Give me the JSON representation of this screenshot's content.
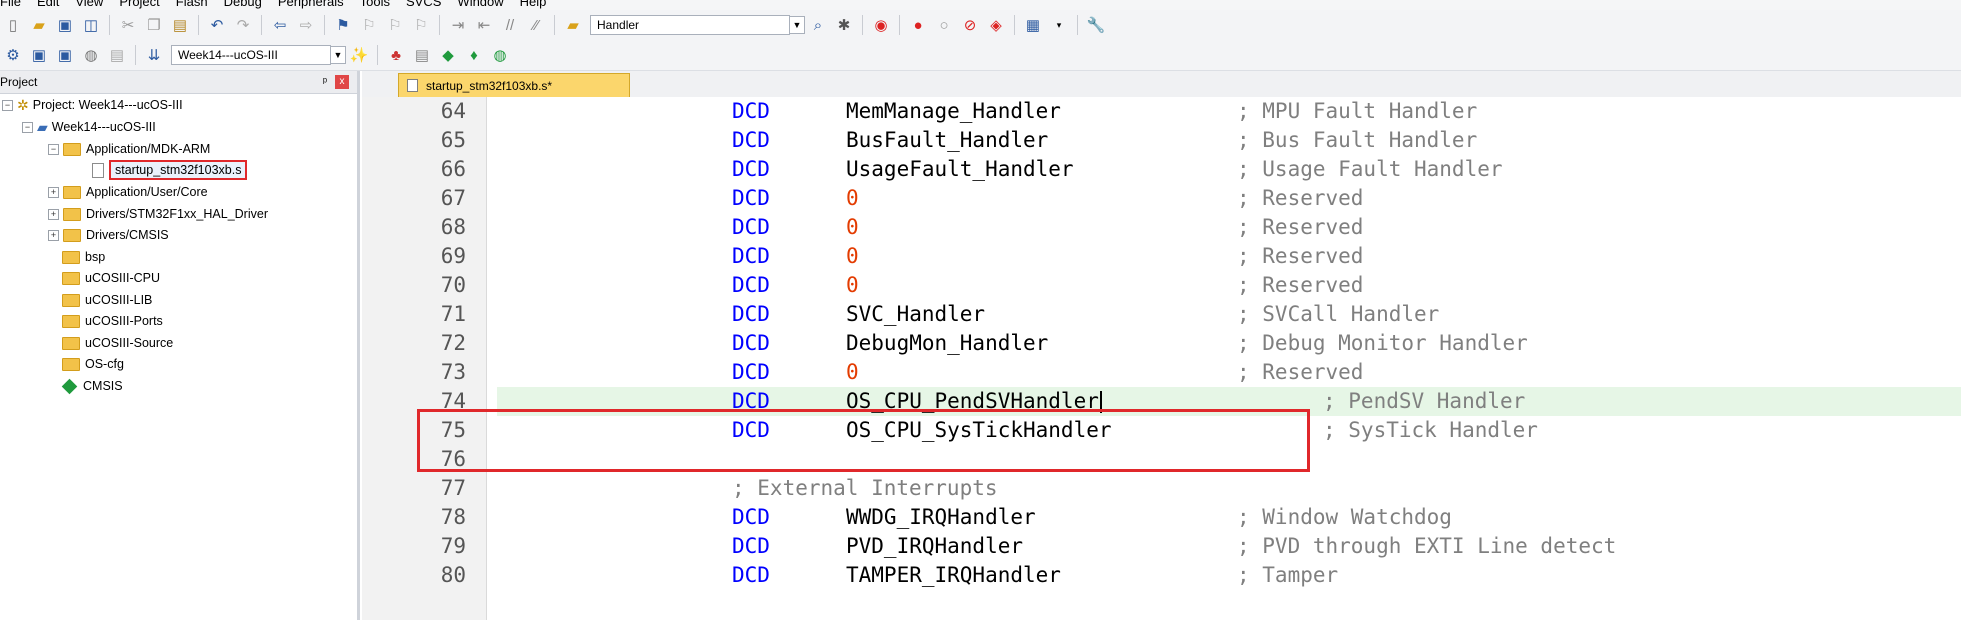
{
  "menubar": {
    "items": [
      "File",
      "Edit",
      "View",
      "Project",
      "Flash",
      "Debug",
      "Peripherals",
      "Tools",
      "SVCS",
      "Window",
      "Help"
    ]
  },
  "toolbar1": {
    "find_combo_value": "Handler"
  },
  "toolbar2": {
    "target_combo_value": "Week14---ucOS-III"
  },
  "project_panel": {
    "title": "Project",
    "pin_label": "ᵖ",
    "close_label": "x",
    "tree": [
      {
        "label": "Project: Week14---ucOS-III"
      },
      {
        "label": "Week14---ucOS-III"
      },
      {
        "label": "Application/MDK-ARM"
      },
      {
        "label": "startup_stm32f103xb.s"
      },
      {
        "label": "Application/User/Core"
      },
      {
        "label": "Drivers/STM32F1xx_HAL_Driver"
      },
      {
        "label": "Drivers/CMSIS"
      },
      {
        "label": "bsp"
      },
      {
        "label": "uCOSIII-CPU"
      },
      {
        "label": "uCOSIII-LIB"
      },
      {
        "label": "uCOSIII-Ports"
      },
      {
        "label": "uCOSIII-Source"
      },
      {
        "label": "OS-cfg"
      },
      {
        "label": "CMSIS"
      }
    ]
  },
  "editor": {
    "tab_label": "startup_stm32f103xb.s*",
    "lines": [
      {
        "num": "64",
        "kw": "DCD",
        "sym": "MemManage_Handler",
        "comment": "; MPU Fault Handler"
      },
      {
        "num": "65",
        "kw": "DCD",
        "sym": "BusFault_Handler",
        "comment": "; Bus Fault Handler"
      },
      {
        "num": "66",
        "kw": "DCD",
        "sym": "UsageFault_Handler",
        "comment": "; Usage Fault Handler"
      },
      {
        "num": "67",
        "kw": "DCD",
        "sym": "0",
        "comment": "; Reserved"
      },
      {
        "num": "68",
        "kw": "DCD",
        "sym": "0",
        "comment": "; Reserved"
      },
      {
        "num": "69",
        "kw": "DCD",
        "sym": "0",
        "comment": "; Reserved"
      },
      {
        "num": "70",
        "kw": "DCD",
        "sym": "0",
        "comment": "; Reserved"
      },
      {
        "num": "71",
        "kw": "DCD",
        "sym": "SVC_Handler",
        "comment": "; SVCall Handler"
      },
      {
        "num": "72",
        "kw": "DCD",
        "sym": "DebugMon_Handler",
        "comment": "; Debug Monitor Handler"
      },
      {
        "num": "73",
        "kw": "DCD",
        "sym": "0",
        "comment": "; Reserved"
      },
      {
        "num": "74",
        "kw": "DCD",
        "sym": "OS_CPU_PendSVHandler",
        "comment": "; PendSV Handler"
      },
      {
        "num": "75",
        "kw": "DCD",
        "sym": "OS_CPU_SysTickHandler",
        "comment": "; SysTick Handler"
      },
      {
        "num": "76",
        "kw": "",
        "sym": "",
        "comment": ""
      },
      {
        "num": "77",
        "kw": "",
        "sym": "",
        "comment": "; External Interrupts"
      },
      {
        "num": "78",
        "kw": "DCD",
        "sym": "WWDG_IRQHandler",
        "comment": "; Window Watchdog"
      },
      {
        "num": "79",
        "kw": "DCD",
        "sym": "PVD_IRQHandler",
        "comment": "; PVD through EXTI Line detect"
      },
      {
        "num": "80",
        "kw": "DCD",
        "sym": "TAMPER_IRQHandler",
        "comment": "; Tamper"
      }
    ]
  },
  "colors": {
    "keyword": "#0000ff",
    "number": "#e33b00",
    "comment": "#7f7f7f",
    "highlight_line": "#e6f6e6",
    "annotation_box": "#e0282b",
    "active_tab": "#fbd66c"
  }
}
